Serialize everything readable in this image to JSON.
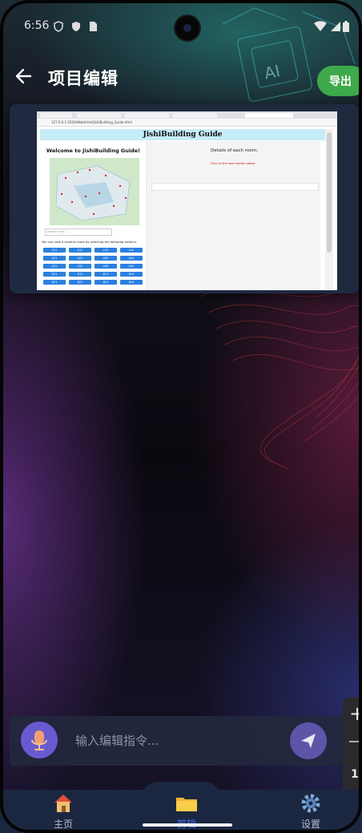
{
  "status_bar": {
    "time": "6:56"
  },
  "header": {
    "title": "项目编辑",
    "export_label": "导出"
  },
  "preview": {
    "page_title": "JishiBuilding Guide",
    "url_text": "127.0.0.1:5500/Web/html/JishiBuilding_Guide.html",
    "welcome": "Welcome to JishiBuilding Guide!",
    "search_placeholder": "please input...",
    "select_prompt": "You can view a location more by selecting the following buttons:",
    "details_heading": "Details of each room:",
    "red_note": "Click on the room button above",
    "rooms": [
      "A11",
      "A12",
      "A13",
      "A14",
      "A21",
      "A22",
      "A23",
      "A24",
      "A31",
      "A32",
      "A33",
      "A34",
      "B11",
      "B12",
      "B13",
      "B14",
      "B21",
      "B22",
      "B23",
      "B24"
    ]
  },
  "command_bar": {
    "placeholder": "输入编辑指令..."
  },
  "zoom_panel": {
    "ratio": "1:"
  },
  "nav": {
    "items": [
      {
        "label": "主页",
        "icon": "home-icon"
      },
      {
        "label": "剪辑",
        "icon": "folder-icon"
      },
      {
        "label": "设置",
        "icon": "gear-icon"
      }
    ],
    "active_index": 1
  },
  "colors": {
    "accent_green": "#3ea94a",
    "nav_active": "#4c6ef5",
    "mic_purple": "#6a5ad0"
  }
}
